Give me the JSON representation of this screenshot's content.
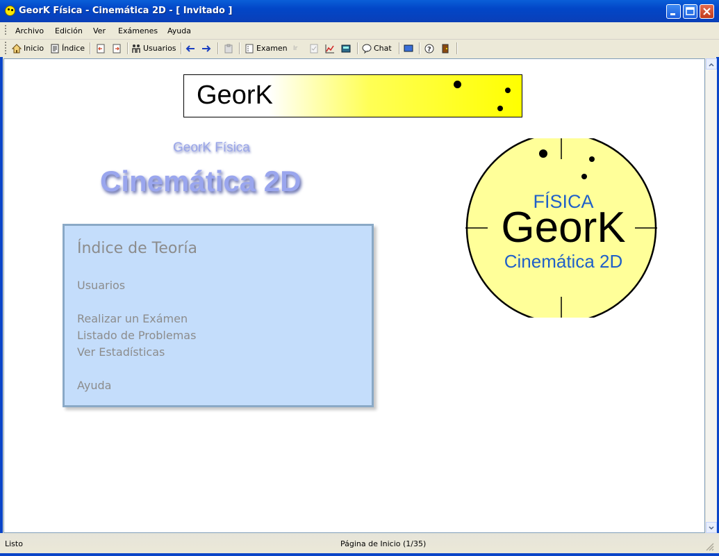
{
  "window": {
    "title": "GeorK Física - Cinemática 2D - [ Invitado ]",
    "icons": [
      "app-icon",
      "minimize-icon",
      "maximize-icon",
      "close-icon"
    ]
  },
  "menubar": {
    "items": [
      "Archivo",
      "Edición",
      "Ver",
      "Exámenes",
      "Ayuda"
    ]
  },
  "toolbar": {
    "inicio": "Inicio",
    "indice": "Índice",
    "usuarios": "Usuarios",
    "examen": "Examen",
    "ir": "Ir",
    "chat": "Chat"
  },
  "banner": {
    "title": "GeorK"
  },
  "header": {
    "subtitle": "GeorK Física",
    "title": "Cinemática 2D"
  },
  "panel": {
    "title": "Índice de Teoría",
    "links": [
      "Usuarios",
      "Realizar un Exámen",
      "Listado de Problemas",
      "Ver Estadísticas",
      "Ayuda"
    ]
  },
  "logo": {
    "line1": "FÍSICA",
    "line2": "GeorK",
    "line3": "Cinemática 2D"
  },
  "statusbar": {
    "left": "Listo",
    "page": "Página de Inicio  (1/35)"
  },
  "colors": {
    "titlebar": "#0a54d4",
    "panel_bg": "#c4ddfb",
    "logo_fill": "#ffff99",
    "logo_text_blue": "#2060c8"
  }
}
